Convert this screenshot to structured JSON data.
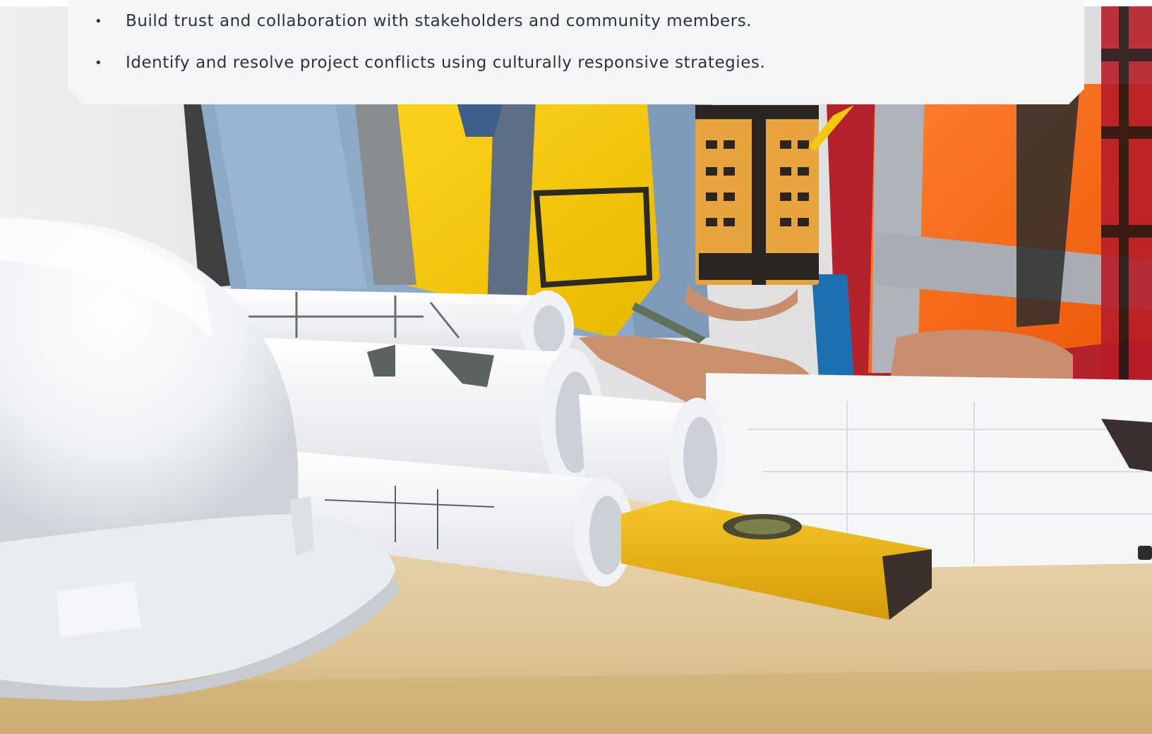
{
  "learning_objectives": {
    "bullet_symbol": "•",
    "items": [
      "Build trust and collaboration with stakeholders and community members.",
      "Identify and resolve project conflicts using culturally responsive strategies."
    ]
  },
  "hero_image": {
    "subject": "construction-planning-desk",
    "accent_colors": {
      "safety_vest_yellow": "#f2c80f",
      "safety_vest_orange": "#ff6a13",
      "desk_wood": "#e3d0a3",
      "hard_hat_white": "#f7f8fa",
      "card_background": "#f4f5f7",
      "text_dark": "#2f3237"
    }
  }
}
